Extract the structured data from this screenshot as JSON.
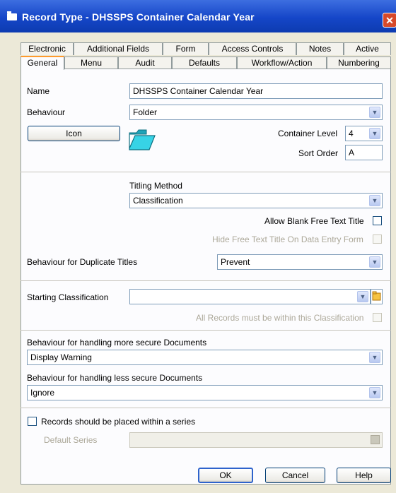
{
  "window": {
    "title": "Record Type - DHSSPS Container Calendar Year",
    "close_glyph": "✕"
  },
  "tabs_back": [
    "Electronic",
    "Additional Fields",
    "Form",
    "Access Controls",
    "Notes",
    "Active"
  ],
  "tabs_front": [
    "General",
    "Menu",
    "Audit",
    "Defaults",
    "Workflow/Action",
    "Numbering"
  ],
  "active_tab": "General",
  "general": {
    "name_label": "Name",
    "name_value": "DHSSPS Container Calendar Year",
    "behaviour_label": "Behaviour",
    "behaviour_value": "Folder",
    "icon_button": "Icon",
    "icon_name": "folder-icon",
    "container_level_label": "Container Level",
    "container_level_value": "4",
    "sort_order_label": "Sort Order",
    "sort_order_value": "A",
    "titling_method_label": "Titling Method",
    "titling_method_value": "Classification",
    "allow_blank_label": "Allow Blank Free Text Title",
    "hide_free_text_label": "Hide Free Text Title On Data Entry Form",
    "duplicate_label": "Behaviour for Duplicate Titles",
    "duplicate_value": "Prevent",
    "starting_class_label": "Starting Classification",
    "starting_class_value": "",
    "all_records_label": "All Records must be within this Classification",
    "more_secure_label": "Behaviour for handling more secure Documents",
    "more_secure_value": "Display Warning",
    "less_secure_label": "Behaviour for handling less secure Documents",
    "less_secure_value": "Ignore",
    "series_label": "Records should be placed within a series",
    "default_series_label": "Default Series",
    "default_series_value": ""
  },
  "buttons": {
    "ok": "OK",
    "cancel": "Cancel",
    "help": "Help"
  },
  "colors": {
    "titlebar": "#1546c8",
    "dialog_bg": "#ece9d8",
    "panel_bg": "#fcfcfe",
    "active_tab_accent": "#ff9a2e"
  }
}
